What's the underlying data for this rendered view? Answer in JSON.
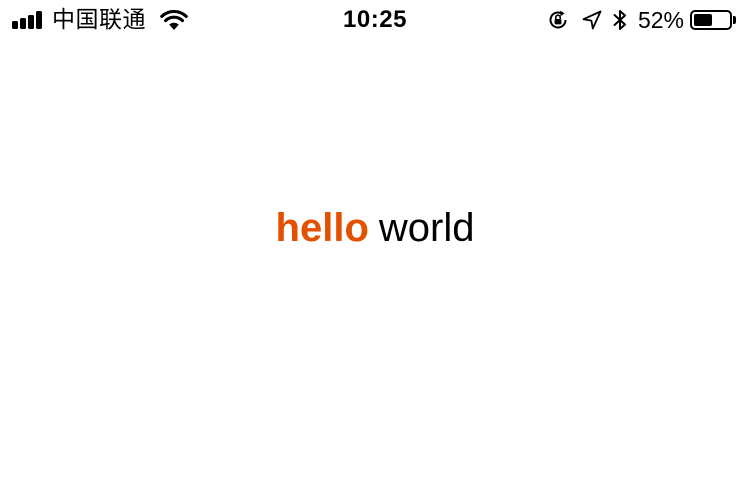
{
  "status_bar": {
    "carrier": "中国联通",
    "time": "10:25",
    "battery_percent": "52%",
    "battery_level": 0.52,
    "signal_bars": 4,
    "icons": [
      "signal-icon",
      "wifi-icon",
      "rotation-lock-icon",
      "location-icon",
      "bluetooth-icon",
      "battery-icon"
    ]
  },
  "content": {
    "greeting_accent": "hello",
    "greeting_rest": "world"
  },
  "colors": {
    "accent": "#e35000",
    "text": "#000000",
    "background": "#ffffff"
  }
}
